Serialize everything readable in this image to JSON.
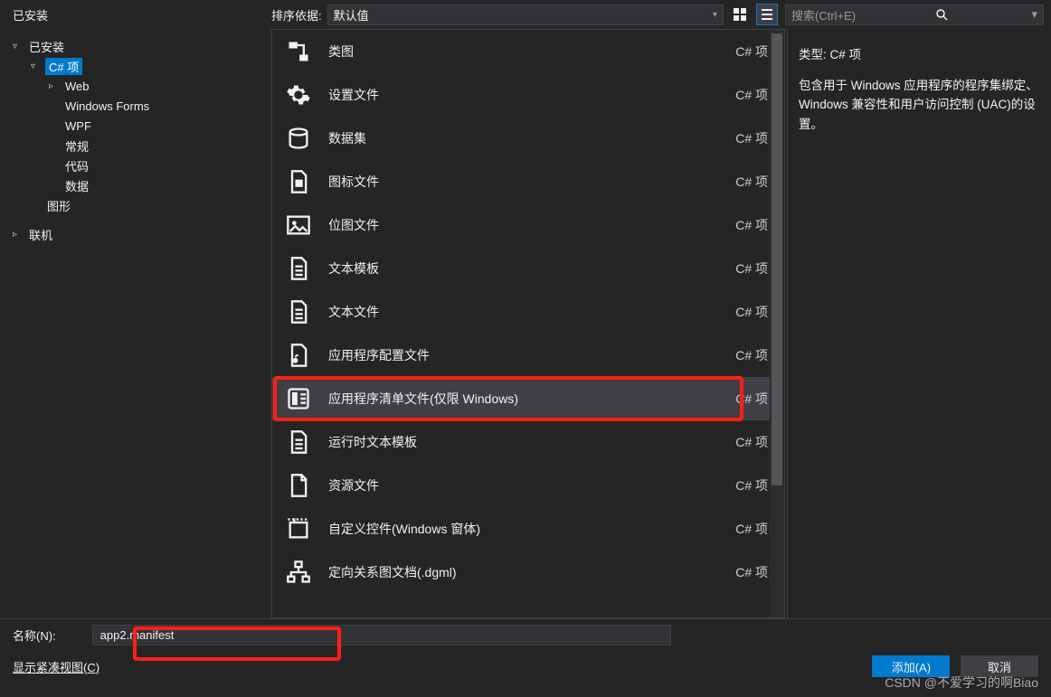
{
  "header": {
    "installed_label": "已安装",
    "sort_label": "排序依据:",
    "sort_value": "默认值",
    "search_placeholder": "搜索(Ctrl+E)"
  },
  "tree": {
    "installed": "已安装",
    "csharp_items": "C# 项",
    "web": "Web",
    "windows_forms": "Windows Forms",
    "wpf": "WPF",
    "general": "常规",
    "code": "代码",
    "data": "数据",
    "graphics": "图形",
    "online": "联机"
  },
  "items": [
    {
      "name": "类图",
      "cat": "C# 项",
      "icon": "class-diagram"
    },
    {
      "name": "设置文件",
      "cat": "C# 项",
      "icon": "gear"
    },
    {
      "name": "数据集",
      "cat": "C# 项",
      "icon": "dataset"
    },
    {
      "name": "图标文件",
      "cat": "C# 项",
      "icon": "icon-file"
    },
    {
      "name": "位图文件",
      "cat": "C# 项",
      "icon": "bitmap"
    },
    {
      "name": "文本模板",
      "cat": "C# 项",
      "icon": "text-file"
    },
    {
      "name": "文本文件",
      "cat": "C# 项",
      "icon": "text-file"
    },
    {
      "name": "应用程序配置文件",
      "cat": "C# 项",
      "icon": "config"
    },
    {
      "name": "应用程序清单文件(仅限 Windows)",
      "cat": "C# 项",
      "icon": "manifest",
      "selected": true
    },
    {
      "name": "运行时文本模板",
      "cat": "C# 项",
      "icon": "text-file"
    },
    {
      "name": "资源文件",
      "cat": "C# 项",
      "icon": "resource"
    },
    {
      "name": "自定义控件(Windows 窗体)",
      "cat": "C# 项",
      "icon": "control"
    },
    {
      "name": "定向关系图文档(.dgml)",
      "cat": "C# 项",
      "icon": "dgml"
    }
  ],
  "detail": {
    "type_label": "类型:",
    "type_value": "C# 项",
    "description": "包含用于 Windows 应用程序的程序集绑定、Windows 兼容性和用户访问控制 (UAC)的设置。"
  },
  "footer": {
    "name_label": "名称(N):",
    "name_value": "app2.manifest",
    "compact_view": "显示紧凑视图(C)",
    "add_button": "添加(A)",
    "cancel_button": "取消"
  },
  "watermark": "CSDN @不爱学习的啊Biao",
  "icons": {
    "grid": "▦",
    "list": "☰",
    "search": "🔍",
    "chev": "▾",
    "arrow_down": "▿",
    "arrow_right": "▹"
  }
}
